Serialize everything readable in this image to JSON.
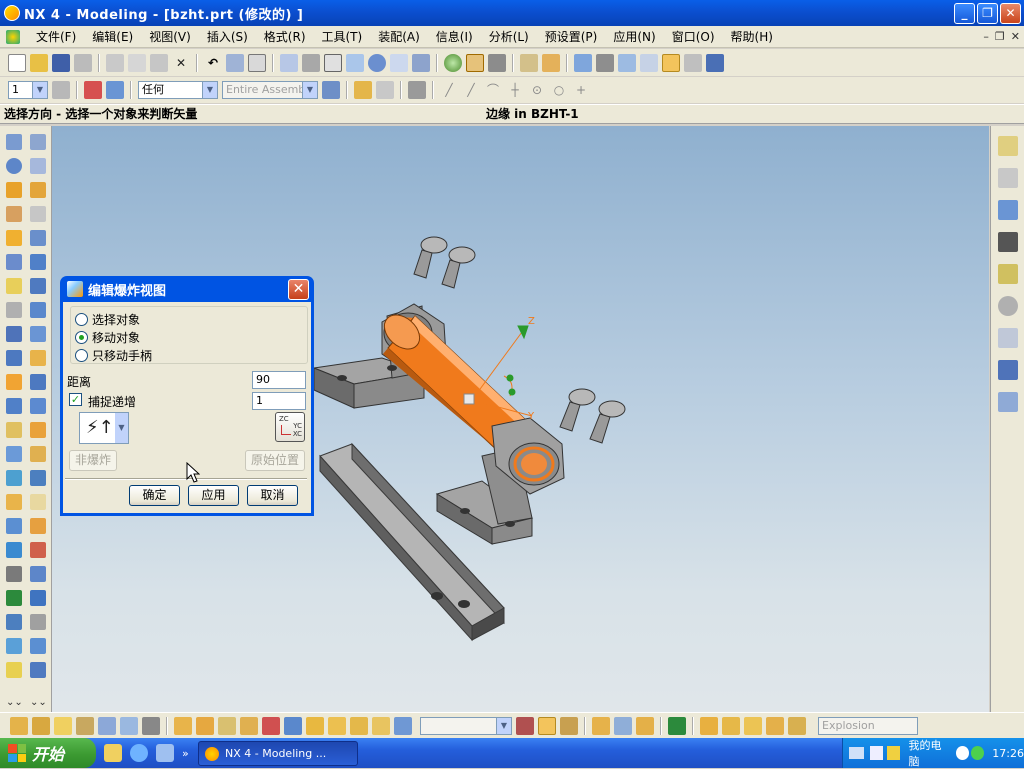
{
  "window": {
    "title": "NX 4 - Modeling - [bzht.prt  (修改的) ]"
  },
  "menu": [
    "文件(F)",
    "编辑(E)",
    "视图(V)",
    "插入(S)",
    "格式(R)",
    "工具(T)",
    "装配(A)",
    "信息(I)",
    "分析(L)",
    "预设置(P)",
    "应用(N)",
    "窗口(O)",
    "帮助(H)"
  ],
  "toolbar2": {
    "layer_value": "1",
    "type_filter": "任何",
    "scope_filter": "Entire Assemb"
  },
  "cue": {
    "prompt": "选择方向 - 选择一个对象来判断矢量",
    "status": "边缘 in BZHT-1"
  },
  "dialog": {
    "title": "编辑爆炸视图",
    "options": [
      "选择对象",
      "移动对象",
      "只移动手柄"
    ],
    "selected_option": "移动对象",
    "distance_label": "距离",
    "distance_value": "90",
    "snap_label": "捕捉递增",
    "snap_checked": true,
    "snap_value": "1",
    "unexplode_button": "非爆炸",
    "original_position_button": "原始位置",
    "ok_button": "确定",
    "apply_button": "应用",
    "cancel_button": "取消"
  },
  "triad_labels": {
    "z": "Z",
    "y": "Y",
    "zc": "ZC",
    "yc": "YC",
    "xc": "XC"
  },
  "bottom_toolbar": {
    "explosion_field": "Explosion"
  },
  "taskbar": {
    "start_label": "开始",
    "task_label": "NX 4 - Modeling ...",
    "tray_label": "我的电脑",
    "clock": "17:26"
  },
  "colors": {
    "part_orange": "#f07a1c",
    "part_gray": "#8e8e8e",
    "viewport_top": "#8fb0cf",
    "viewport_bottom": "#e0e6ea",
    "xp_blue": "#0054e3"
  }
}
